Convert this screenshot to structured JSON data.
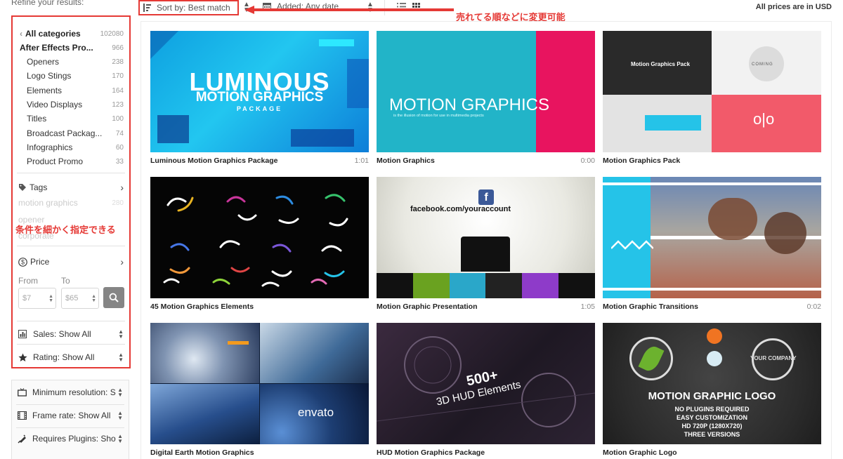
{
  "refine_label": "Refine your results:",
  "toolbar": {
    "sort_label": "Sort by: Best match",
    "date_label": "Added: Any date",
    "prices_note": "All prices are in USD"
  },
  "annotations": {
    "top": "売れてる順などに変更可能",
    "side": "条件を細かく指定できる"
  },
  "sidebar": {
    "categories": [
      {
        "name": "All categories",
        "count": "102080"
      },
      {
        "name": "After Effects Pro...",
        "count": "966"
      },
      {
        "name": "Openers",
        "count": "238"
      },
      {
        "name": "Logo Stings",
        "count": "170"
      },
      {
        "name": "Elements",
        "count": "164"
      },
      {
        "name": "Video Displays",
        "count": "123"
      },
      {
        "name": "Titles",
        "count": "100"
      },
      {
        "name": "Broadcast Packag...",
        "count": "74"
      },
      {
        "name": "Infographics",
        "count": "60"
      },
      {
        "name": "Product Promo",
        "count": "33"
      }
    ],
    "tags": {
      "label": "Tags",
      "faded_items": [
        {
          "name": "motion graphics",
          "count": "280"
        },
        {
          "name": "opener",
          "count": ""
        },
        {
          "name": "corporate",
          "count": ""
        }
      ]
    },
    "price": {
      "label": "Price",
      "from_label": "From",
      "to_label": "To",
      "from_placeholder": "$7",
      "to_placeholder": "$65"
    },
    "sales_label": "Sales: Show All",
    "rating_label": "Rating: Show All"
  },
  "filters2": {
    "resolution_label": "Minimum resolution: S",
    "framerate_label": "Frame rate: Show All",
    "plugins_label": "Requires Plugins: Sho"
  },
  "items": [
    {
      "title": "Luminous Motion Graphics Package",
      "duration": "1:01",
      "thumb_lines": [
        "LUMINOUS",
        "MOTION GRAPHICS",
        "PACKAGE"
      ]
    },
    {
      "title": "Motion Graphics",
      "duration": "0:00",
      "thumb_lines": [
        "MOTION GRAPHICS",
        "is the illusion of motion for use in multimedia projects"
      ]
    },
    {
      "title": "Motion Graphics Pack",
      "duration": "",
      "thumb_lines": [
        "Motion Graphics Pack",
        "COMING"
      ]
    },
    {
      "title": "45 Motion Graphics Elements",
      "duration": "",
      "thumb_lines": []
    },
    {
      "title": "Motion Graphic Presentation",
      "duration": "1:05",
      "thumb_lines": [
        "facebook.com/youraccount"
      ]
    },
    {
      "title": "Motion Graphic Transitions",
      "duration": "0:02",
      "thumb_lines": []
    },
    {
      "title": "Digital Earth Motion Graphics",
      "duration": "",
      "thumb_lines": [
        "envato"
      ]
    },
    {
      "title": "HUD Motion Graphics Package",
      "duration": "",
      "thumb_lines": [
        "500+",
        "3D HUD Elements"
      ]
    },
    {
      "title": "Motion Graphic Logo",
      "duration": "",
      "thumb_lines": [
        "MOTION GRAPHIC LOGO",
        "NO PLUGINS REQUIRED",
        "EASY CUSTOMIZATION",
        "HD 720P (1280X720)",
        "THREE VERSIONS",
        "YOUR COMPANY"
      ]
    }
  ],
  "colors": {
    "annotation": "#e53935",
    "cyan": "#25c3e8",
    "pink": "#e8145f",
    "coral": "#f25a6a"
  }
}
